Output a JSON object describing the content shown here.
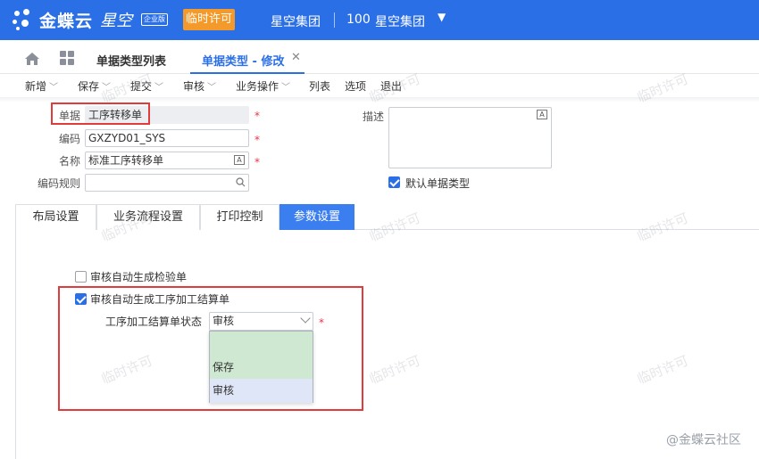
{
  "header": {
    "brand": "金蝶云",
    "product": "星空",
    "edition": "企业版",
    "license_button": "临时许可",
    "org_name": "星空集团",
    "org_code": "100",
    "org_selected": "星空集团"
  },
  "tabs": {
    "list_tab": "单据类型列表",
    "active_tab": "单据类型 - 修改"
  },
  "toolbar": {
    "items": [
      "新增",
      "保存",
      "提交",
      "审核",
      "业务操作",
      "列表",
      "选项",
      "退出"
    ]
  },
  "form": {
    "bill_label": "单据",
    "bill_value": "工序转移单",
    "code_label": "编码",
    "code_value": "GXZYD01_SYS",
    "name_label": "名称",
    "name_value": "标准工序转移单",
    "rule_label": "编码规则",
    "rule_value": "",
    "desc_label": "描述",
    "default_type_label": "默认单据类型",
    "default_type_checked": true
  },
  "subtabs": [
    "布局设置",
    "业务流程设置",
    "打印控制",
    "参数设置"
  ],
  "params": {
    "auto_inspect_label": "审核自动生成检验单",
    "auto_inspect_checked": false,
    "auto_settle_label": "审核自动生成工序加工结算单",
    "auto_settle_checked": true,
    "settle_status_label": "工序加工结算单状态",
    "settle_status_value": "审核",
    "options": [
      "",
      "保存",
      "审核"
    ]
  },
  "watermark": "临时许可",
  "footer": "@金蝶云社区",
  "colors": {
    "primary": "#2b6fe6",
    "license": "#f49a2a",
    "highlight": "#e23b3b",
    "option_save_bg": "#cfe8d1",
    "option_audit_bg": "#dfe6f8"
  }
}
